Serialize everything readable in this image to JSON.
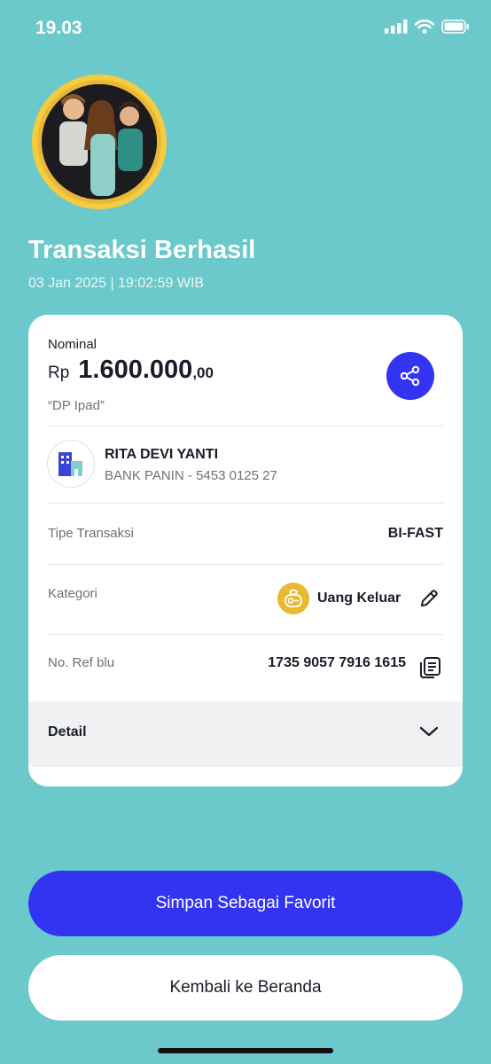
{
  "status_bar": {
    "time": "19.03"
  },
  "header": {
    "title": "Transaksi Berhasil",
    "datetime": "03 Jan 2025  |  19:02:59 WIB"
  },
  "transaction": {
    "nominal_label": "Nominal",
    "currency": "Rp",
    "amount": "1.600.000",
    "decimals": ",00",
    "note": "“DP Ipad”",
    "recipient_name": "RITA DEVI YANTI",
    "recipient_bank": "BANK PANIN - 5453 0125 27",
    "type_label": "Tipe Transaksi",
    "type_value": "BI-FAST",
    "category_label": "Kategori",
    "category_value": "Uang Keluar",
    "ref_label": "No. Ref blu",
    "ref_value": "1735 9057 7916 1615",
    "detail_label": "Detail"
  },
  "buttons": {
    "favorite": "Simpan Sebagai Favorit",
    "home": "Kembali ke Beranda"
  },
  "colors": {
    "background": "#6BC9CB",
    "accent": "#3333F2",
    "category": "#E9B834"
  }
}
